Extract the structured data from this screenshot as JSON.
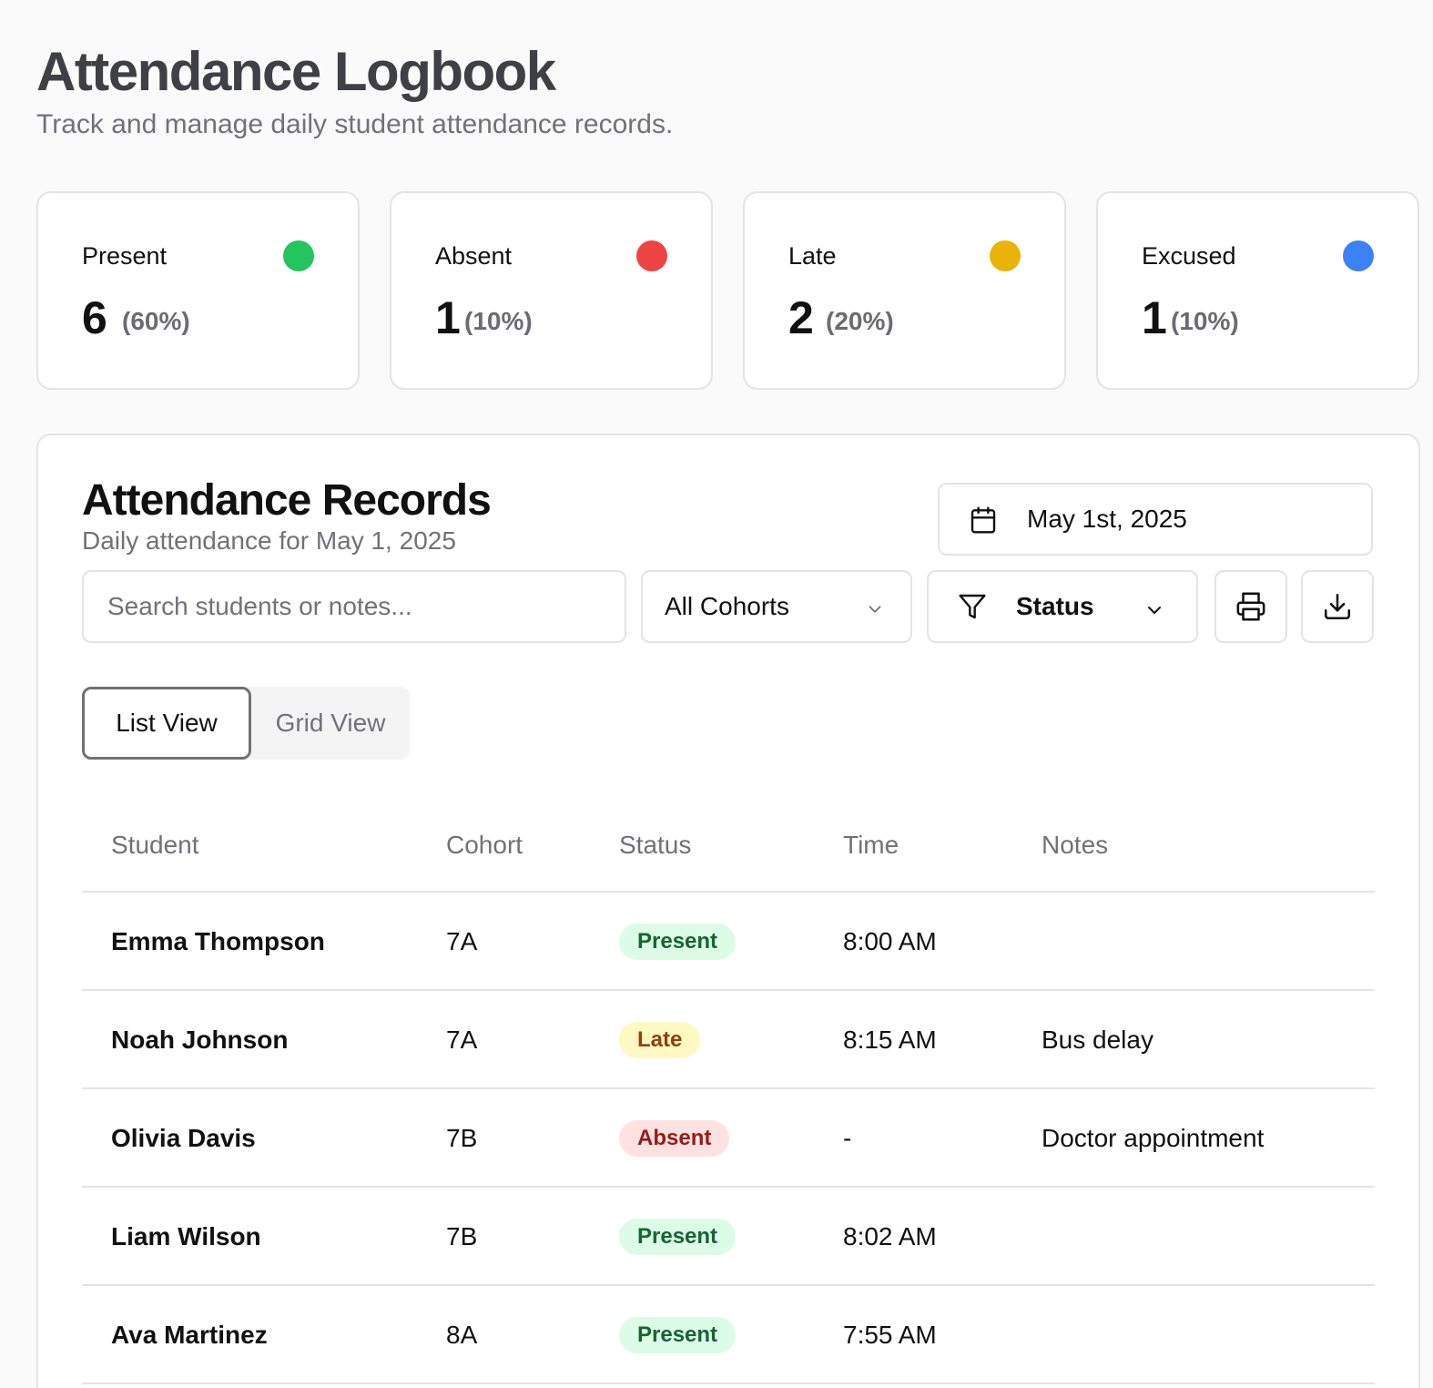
{
  "header": {
    "title": "Attendance Logbook",
    "subtitle": "Track and manage daily student attendance records."
  },
  "stats": [
    {
      "label": "Present",
      "count": "6",
      "percent": "(60%)",
      "color": "#22c55e"
    },
    {
      "label": "Absent",
      "count": "1",
      "percent": "(10%)",
      "color": "#ef4444"
    },
    {
      "label": "Late",
      "count": "2",
      "percent": "(20%)",
      "color": "#eab308"
    },
    {
      "label": "Excused",
      "count": "1",
      "percent": "(10%)",
      "color": "#3b82f6"
    }
  ],
  "records": {
    "title": "Attendance Records",
    "subtitle": "Daily attendance for May 1, 2025",
    "date_button": {
      "label": "May 1st, 2025",
      "icon": "calendar-icon"
    },
    "search": {
      "placeholder": "Search students or notes...",
      "value": ""
    },
    "cohort_select": {
      "selected": "All Cohorts",
      "icon": "chevron-down-icon"
    },
    "status_filter": {
      "label": "Status",
      "icon": "filter-icon"
    },
    "actions": [
      {
        "name": "print",
        "icon": "printer-icon"
      },
      {
        "name": "export",
        "icon": "download-icon"
      }
    ],
    "views": {
      "list": "List View",
      "grid": "Grid View",
      "active": "list"
    },
    "columns": [
      "Student",
      "Cohort",
      "Status",
      "Time",
      "Notes"
    ],
    "rows": [
      {
        "student": "Emma Thompson",
        "cohort": "7A",
        "status": "Present",
        "time": "8:00 AM",
        "notes": ""
      },
      {
        "student": "Noah Johnson",
        "cohort": "7A",
        "status": "Late",
        "time": "8:15 AM",
        "notes": "Bus delay"
      },
      {
        "student": "Olivia Davis",
        "cohort": "7B",
        "status": "Absent",
        "time": "-",
        "notes": "Doctor appointment"
      },
      {
        "student": "Liam Wilson",
        "cohort": "7B",
        "status": "Present",
        "time": "8:02 AM",
        "notes": ""
      },
      {
        "student": "Ava Martinez",
        "cohort": "8A",
        "status": "Present",
        "time": "7:55 AM",
        "notes": ""
      }
    ]
  },
  "status_colors": {
    "Present": {
      "bg": "#dcfce7",
      "fg": "#166534"
    },
    "Late": {
      "bg": "#fef9c3",
      "fg": "#92400e"
    },
    "Absent": {
      "bg": "#fee2e2",
      "fg": "#991b1b"
    }
  }
}
